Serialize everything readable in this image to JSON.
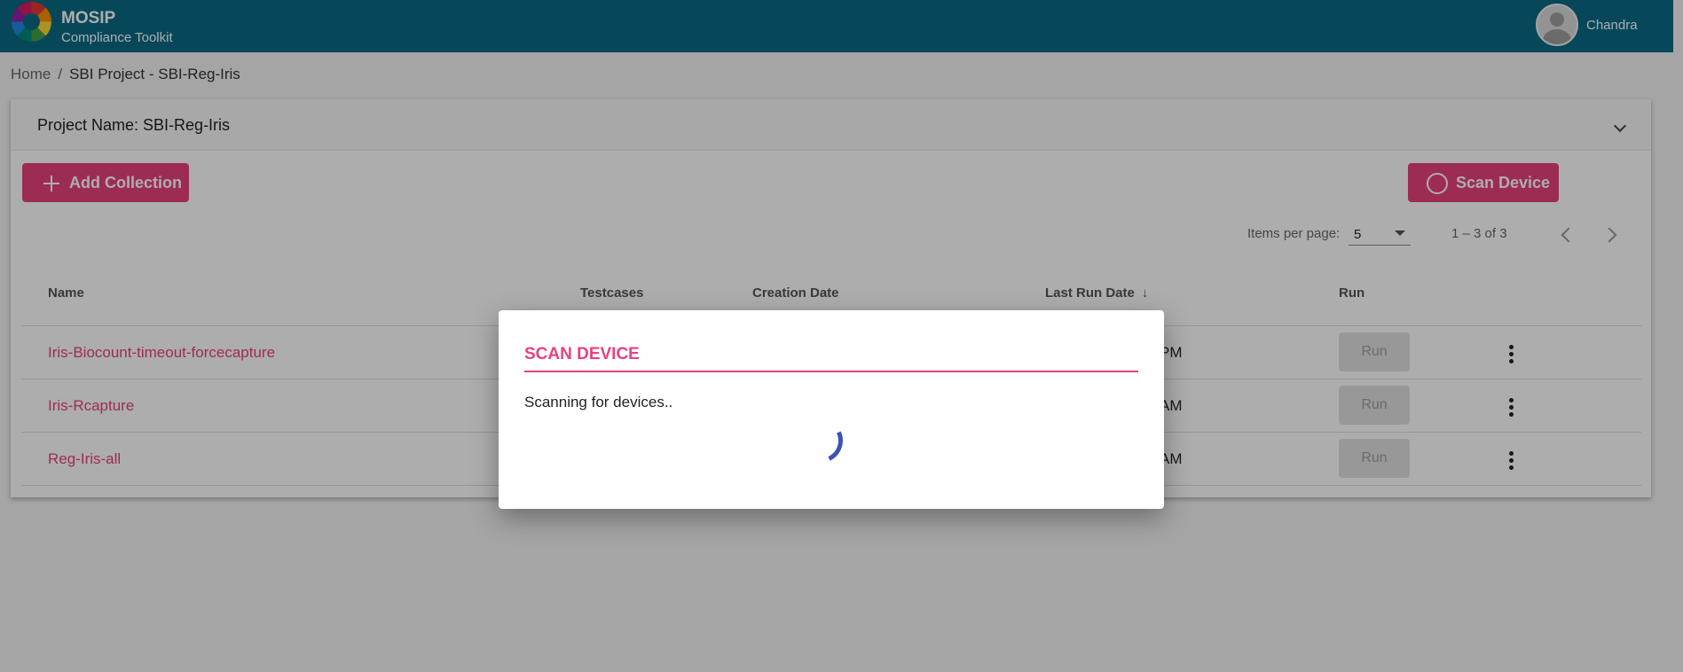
{
  "app": {
    "name": "MOSIP",
    "subtitle": "Compliance Toolkit",
    "user": "Chandra"
  },
  "breadcrumb": {
    "home": "Home",
    "separator": "/",
    "current": "SBI Project - SBI-Reg-Iris"
  },
  "panel": {
    "project_name": "Project Name: SBI-Reg-Iris"
  },
  "toolbar": {
    "add_collection": "Add Collection",
    "scan_device": "Scan Device"
  },
  "pagination": {
    "items_per_page_label": "Items per page:",
    "items_per_page": "5",
    "range": "1 – 3 of 3"
  },
  "table": {
    "headers": {
      "name": "Name",
      "testcases": "Testcases",
      "creation_date": "Creation Date",
      "last_run_date": "Last Run Date",
      "run": "Run"
    },
    "rows": [
      {
        "name": "Iris-Biocount-timeout-forcecapture",
        "last_run_partial": "PM",
        "run": "Run"
      },
      {
        "name": "Iris-Rcapture",
        "last_run_partial": "AM",
        "run": "Run"
      },
      {
        "name": "Reg-Iris-all",
        "last_run_partial": "AM",
        "run": "Run"
      }
    ]
  },
  "dialog": {
    "title": "SCAN DEVICE",
    "message": "Scanning for devices.."
  },
  "colors": {
    "header": "#0a6b85",
    "accent": "#e8417e",
    "spinner": "#3f51b5"
  },
  "icons": [
    "mosip-logo",
    "avatar-icon",
    "chevron-down-icon",
    "plus-icon",
    "circle-icon",
    "dropdown-caret-icon",
    "chevron-left-icon",
    "chevron-right-icon",
    "arrow-down-icon",
    "more-vert-icon",
    "spinner-icon"
  ]
}
